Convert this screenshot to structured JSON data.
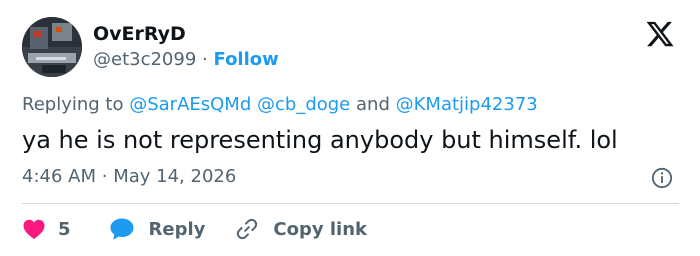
{
  "author": {
    "display_name": "OvErRyD",
    "handle": "@et3c2099",
    "separator": "·",
    "follow_label": "Follow"
  },
  "reply_context": {
    "prefix": "Replying to",
    "mentions": [
      "@SarAEsQMd",
      "@cb_doge",
      "@KMatjip42373"
    ],
    "conjunction": "and"
  },
  "tweet": {
    "text": "ya he is not representing anybody but himself. lol"
  },
  "meta": {
    "time": "4:46 AM",
    "separator": "·",
    "date": "May 14, 2026"
  },
  "actions": {
    "like_count": "5",
    "reply_label": "Reply",
    "copy_link_label": "Copy link"
  },
  "colors": {
    "text_primary": "#0f1419",
    "text_secondary": "#536471",
    "accent": "#1d9bf0",
    "like": "#f91880",
    "divider": "#cfd9de"
  },
  "icons": {
    "logo": "x-logo",
    "info": "info-icon",
    "like": "heart-icon",
    "reply": "speech-bubble-icon",
    "copy_link": "link-icon"
  }
}
